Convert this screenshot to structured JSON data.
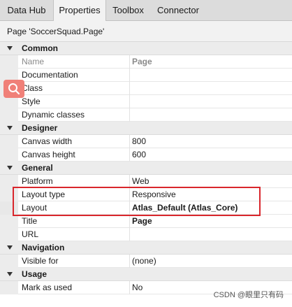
{
  "tabs": [
    "Data Hub",
    "Properties",
    "Toolbox",
    "Connector"
  ],
  "panel_title": "Page 'SoccerSquad.Page'",
  "common": {
    "label": "Common",
    "name_label": "Name",
    "name_value": "Page",
    "documentation_label": "Documentation",
    "class_label": "Class",
    "style_label": "Style",
    "dynamic_classes_label": "Dynamic classes"
  },
  "designer": {
    "label": "Designer",
    "canvas_width_label": "Canvas width",
    "canvas_width_value": "800",
    "canvas_height_label": "Canvas height",
    "canvas_height_value": "600"
  },
  "general": {
    "label": "General",
    "platform_label": "Platform",
    "platform_value": "Web",
    "layout_type_label": "Layout type",
    "layout_type_value": "Responsive",
    "layout_label": "Layout",
    "layout_value": "Atlas_Default (Atlas_Core)",
    "title_label": "Title",
    "title_value": "Page",
    "url_label": "URL"
  },
  "navigation": {
    "label": "Navigation",
    "visible_for_label": "Visible for",
    "visible_for_value": "(none)"
  },
  "usage": {
    "label": "Usage",
    "mark_as_used_label": "Mark as used",
    "mark_as_used_value": "No"
  },
  "watermark": "CSDN @眼里只有码",
  "colors": {
    "highlight": "#d9262c",
    "search_button": "#f08078"
  },
  "icons": {
    "search": "search-icon",
    "expand": "chevron-down-icon"
  }
}
